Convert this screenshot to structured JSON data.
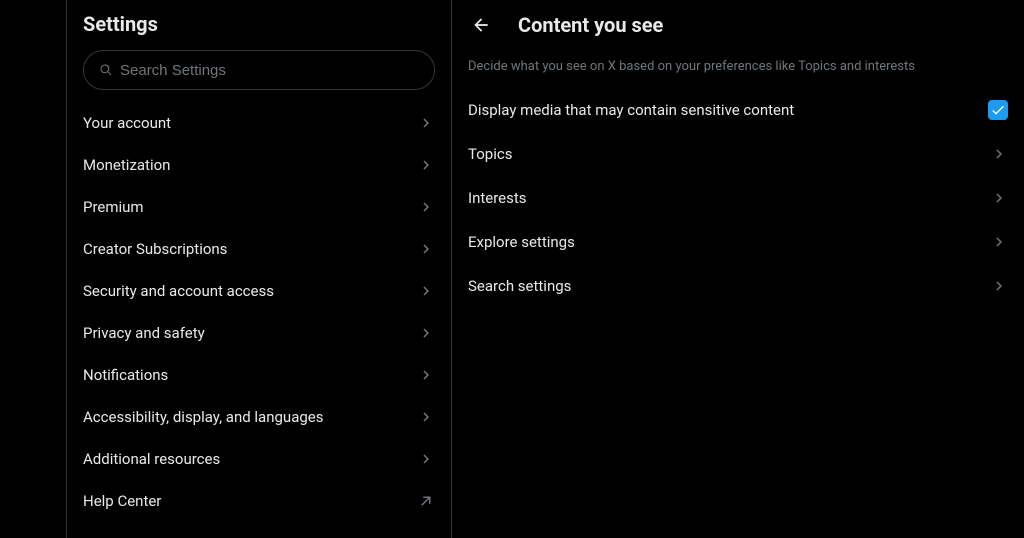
{
  "settings": {
    "title": "Settings",
    "search": {
      "placeholder": "Search Settings",
      "value": ""
    },
    "items": [
      {
        "label": "Your account",
        "type": "nav"
      },
      {
        "label": "Monetization",
        "type": "nav"
      },
      {
        "label": "Premium",
        "type": "nav"
      },
      {
        "label": "Creator Subscriptions",
        "type": "nav"
      },
      {
        "label": "Security and account access",
        "type": "nav"
      },
      {
        "label": "Privacy and safety",
        "type": "nav"
      },
      {
        "label": "Notifications",
        "type": "nav"
      },
      {
        "label": "Accessibility, display, and languages",
        "type": "nav"
      },
      {
        "label": "Additional resources",
        "type": "nav"
      },
      {
        "label": "Help Center",
        "type": "external"
      }
    ]
  },
  "content": {
    "title": "Content you see",
    "description": "Decide what you see on X based on your preferences like Topics and interests",
    "sensitive": {
      "label": "Display media that may contain sensitive content",
      "checked": true
    },
    "rows": [
      {
        "label": "Topics"
      },
      {
        "label": "Interests"
      },
      {
        "label": "Explore settings"
      },
      {
        "label": "Search settings"
      }
    ]
  },
  "colors": {
    "accent": "#1d9bf0",
    "background": "#000000",
    "border": "#2f3336",
    "textPrimary": "#e7e9ea",
    "textSecondary": "#71767b"
  }
}
